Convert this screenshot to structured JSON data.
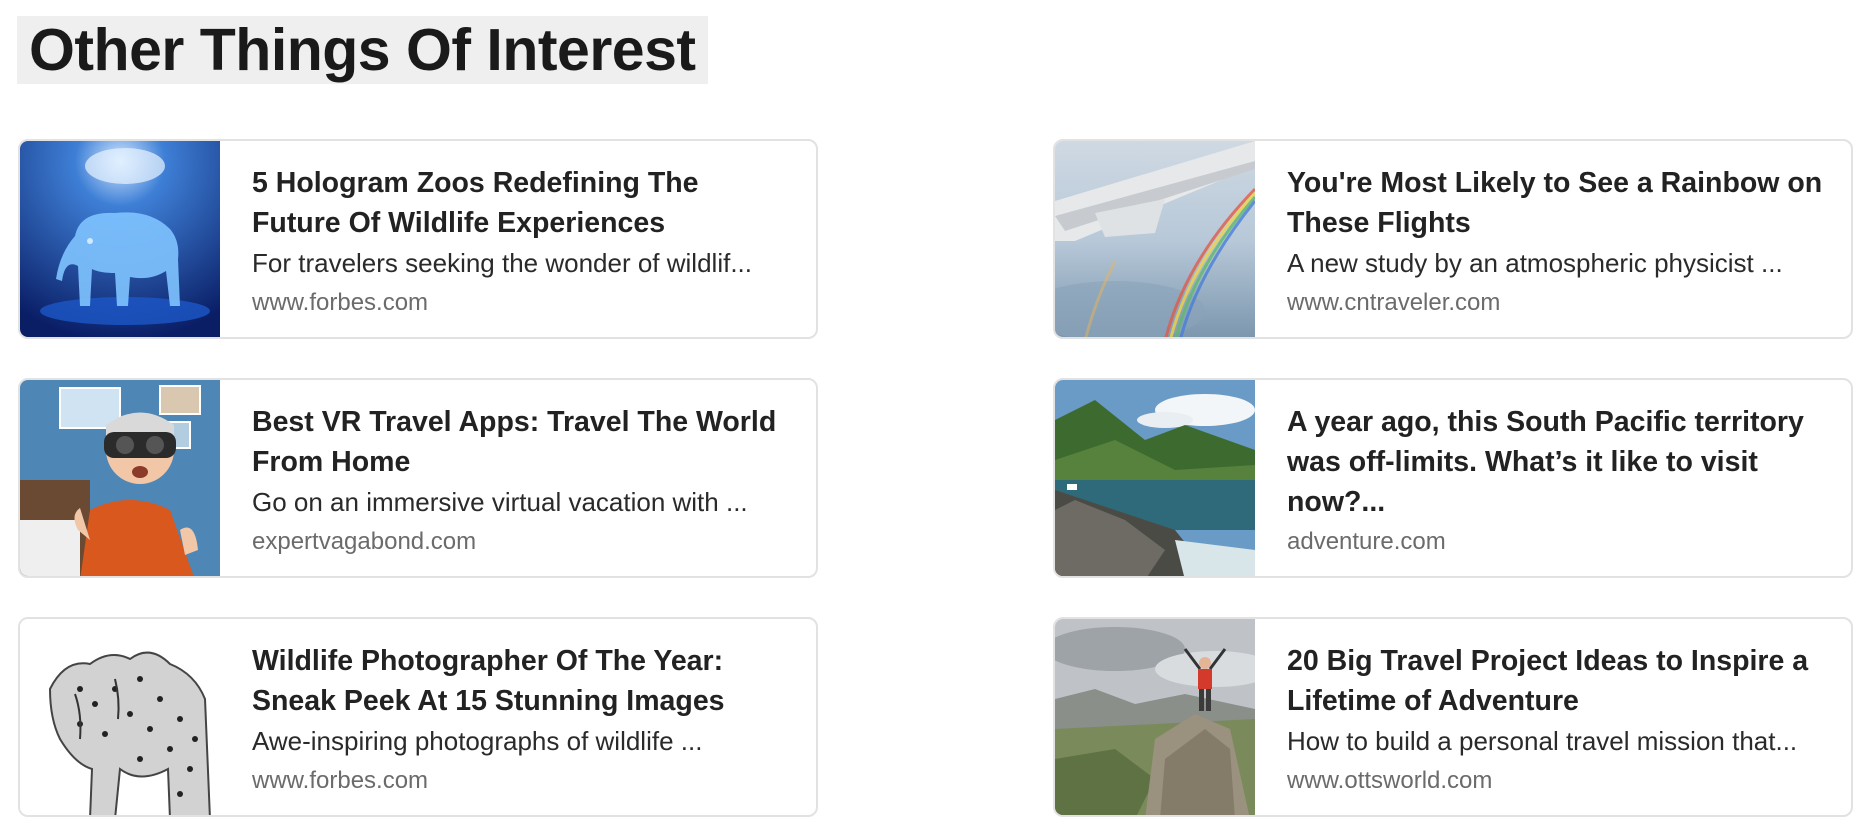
{
  "section": {
    "title": "Other Things Of Interest"
  },
  "cards": [
    {
      "title": "5 Hologram Zoos Redefining The Future Of Wildlife Experiences",
      "description": "For travelers seeking the wonder of wildlif...",
      "source": "www.forbes.com",
      "image": "hologram-elephant"
    },
    {
      "title": "You're Most Likely to See a Rainbow on These Flights",
      "description": "A new study by an atmospheric physicist ...",
      "source": "www.cntraveler.com",
      "image": "airplane-wing-rainbow"
    },
    {
      "title": "Best VR Travel Apps: Travel The World From Home",
      "description": "Go on an immersive virtual vacation with ...",
      "source": "expertvagabond.com",
      "image": "man-vr-headset"
    },
    {
      "title": "A year ago, this  South Pacific territory was off-limits. What’s it like to visit now?...",
      "description": "",
      "source": "adventure.com",
      "image": "coastal-mountains"
    },
    {
      "title": "Wildlife Photographer Of The Year: Sneak Peek At 15 Stunning Images",
      "description": "Awe-inspiring photographs of wildlife ...",
      "source": "www.forbes.com",
      "image": "cheetahs"
    },
    {
      "title": "20 Big Travel Project Ideas to Inspire a Lifetime of Adventure",
      "description": "How to build a personal travel mission that...",
      "source": "www.ottsworld.com",
      "image": "hiker-on-rock"
    }
  ]
}
